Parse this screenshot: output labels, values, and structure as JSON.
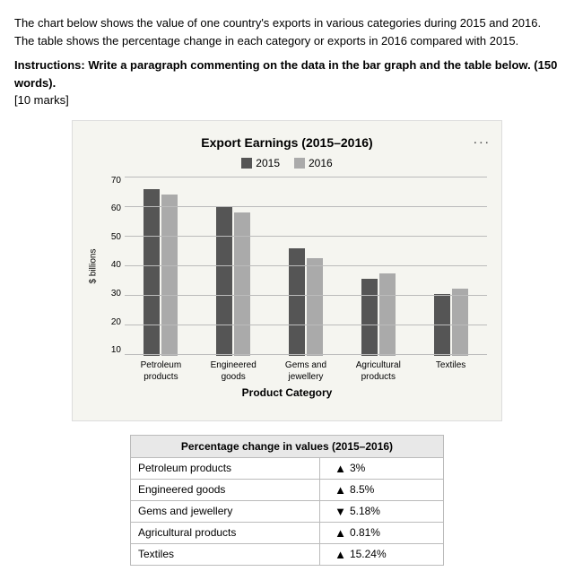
{
  "intro": {
    "text": "The chart below shows the value of one country's exports in various categories during 2015 and 2016. The table shows the percentage change in each category or exports in 2016 compared with 2015.",
    "instructions": "Instructions: Write a paragraph commenting on the data in the bar graph and the table below. (150 words).",
    "marks": "[10 marks]"
  },
  "chart": {
    "title": "Export Earnings (2015–2016)",
    "legend_2015": "2015",
    "legend_2016": "2016",
    "y_axis_label": "$ billions",
    "x_axis_title": "Product Category",
    "more_button": "...",
    "y_ticks": [
      "70",
      "60",
      "50",
      "40",
      "30",
      "20",
      "10"
    ],
    "categories": [
      {
        "label": "Petroleum\nproducts",
        "val_2015": 65,
        "val_2016": 63
      },
      {
        "label": "Engineered\ngoods",
        "val_2015": 58,
        "val_2016": 56
      },
      {
        "label": "Gems and\njewellery",
        "val_2015": 42,
        "val_2016": 38
      },
      {
        "label": "Agricultural\nproducts",
        "val_2015": 30,
        "val_2016": 32
      },
      {
        "label": "Textiles",
        "val_2015": 24,
        "val_2016": 26
      }
    ]
  },
  "table": {
    "header": "Percentage change in values (2015–2016)",
    "rows": [
      {
        "category": "Petroleum products",
        "direction": "up",
        "value": "3%"
      },
      {
        "category": "Engineered goods",
        "direction": "up",
        "value": "8.5%"
      },
      {
        "category": "Gems and jewellery",
        "direction": "down",
        "value": "5.18%"
      },
      {
        "category": "Agricultural products",
        "direction": "up",
        "value": "0.81%"
      },
      {
        "category": "Textiles",
        "direction": "up",
        "value": "15.24%"
      }
    ]
  }
}
